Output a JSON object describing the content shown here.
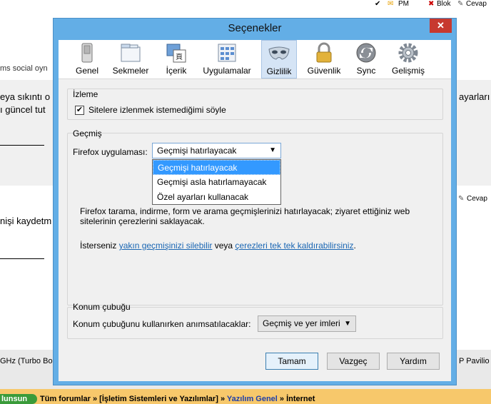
{
  "background": {
    "top_links": [
      "PM",
      "Blok",
      "Cevap"
    ],
    "left_text1": "ms social oyn",
    "left_text2": "eya sıkıntı o",
    "left_text3": "ı güncel tut",
    "right_text1": "ayarları",
    "left_text4": "nişi kaydetm",
    "right_cevap": "Cevap",
    "left_text5": "GHz (Turbo Bo",
    "right_text2": "P Pavilio",
    "breadcrumb_badge": "lunsun",
    "breadcrumb": [
      "Tüm forumlar",
      "[İşletim Sistemleri ve Yazılımlar]",
      "Yazılım Genel",
      "İnternet"
    ],
    "breadcrumb_sep": "»"
  },
  "dialog": {
    "title": "Seçenekler",
    "close_label": "✕",
    "tabs": [
      {
        "label": "Genel",
        "icon": "switch-icon"
      },
      {
        "label": "Sekmeler",
        "icon": "tabs-icon"
      },
      {
        "label": "İçerik",
        "icon": "content-icon"
      },
      {
        "label": "Uygulamalar",
        "icon": "applications-icon"
      },
      {
        "label": "Gizlilik",
        "icon": "mask-icon"
      },
      {
        "label": "Güvenlik",
        "icon": "lock-icon"
      },
      {
        "label": "Sync",
        "icon": "sync-icon"
      },
      {
        "label": "Gelişmiş",
        "icon": "gear-icon"
      }
    ],
    "selected_tab": "Gizlilik",
    "tracking": {
      "title": "İzleme",
      "checkbox_label": "Sitelere izlenmek istemediğimi söyle",
      "checked": true
    },
    "history": {
      "title": "Geçmiş",
      "firefox_label": "Firefox uygulaması:",
      "selected_value": "Geçmişi hatırlayacak",
      "options": [
        "Geçmişi hatırlayacak",
        "Geçmişi asla hatırlamayacak",
        "Özel ayarları kullanacak"
      ],
      "desc_line1_prefix": "Firefox tarama, indirme, form ve arama geçmişlerinizi hatırlayacak; ziyaret ettiğiniz web",
      "desc_line2": "sitelerinin çerezlerini saklayacak.",
      "clear_prefix": "İsterseniz ",
      "clear_link1": "yakın geçmişinizi silebilir",
      "clear_middle": " veya ",
      "clear_link2": "çerezleri tek tek kaldırabilirsiniz",
      "clear_suffix": "."
    },
    "location_bar": {
      "title": "Konum çubuğu",
      "label": "Konum çubuğunu kullanırken anımsatılacaklar:",
      "selected_value": "Geçmiş ve yer imleri"
    },
    "buttons": {
      "ok": "Tamam",
      "cancel": "Vazgeç",
      "help": "Yardım"
    }
  }
}
